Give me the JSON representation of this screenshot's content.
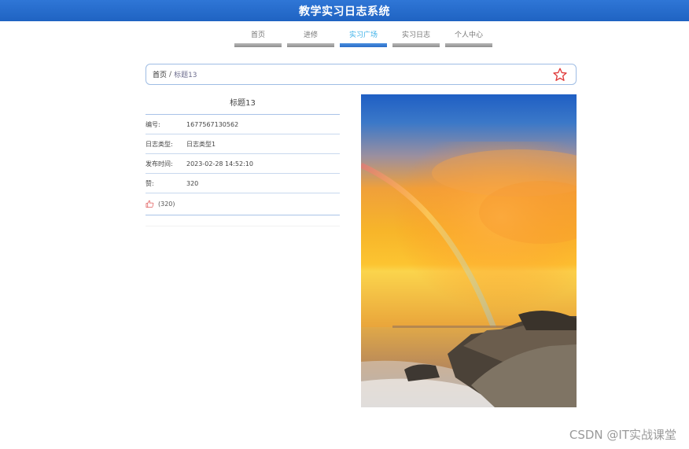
{
  "header": {
    "title": "教学实习日志系统"
  },
  "nav": {
    "items": [
      {
        "label": "首页"
      },
      {
        "label": "进修"
      },
      {
        "label": "实习广场"
      },
      {
        "label": "实习日志"
      },
      {
        "label": "个人中心"
      }
    ],
    "active_index": 2
  },
  "breadcrumb": {
    "home": "首页",
    "separator": "/",
    "current": "标题13"
  },
  "detail": {
    "title": "标题13",
    "rows": [
      {
        "label": "编号:",
        "value": "1677567130562"
      },
      {
        "label": "日志类型:",
        "value": "日志类型1"
      },
      {
        "label": "发布时间:",
        "value": "2023-02-28 14:52:10"
      },
      {
        "label": "赞:",
        "value": "320"
      }
    ],
    "like_count": "(320)"
  },
  "watermark": "CSDN @IT实战课堂",
  "colors": {
    "header": "#2a6cd0",
    "accent": "#3ab0e8",
    "star": "#e03a3a"
  }
}
